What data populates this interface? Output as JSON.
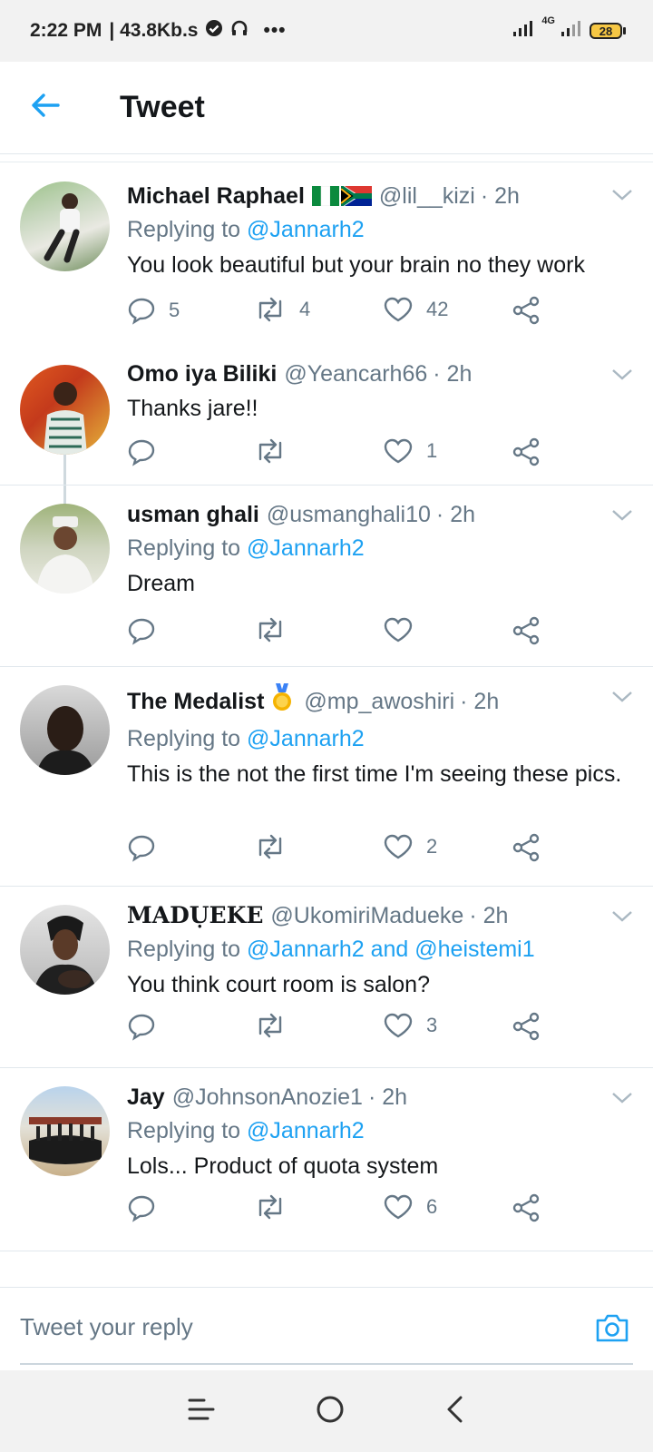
{
  "status_bar": {
    "time": "2:22 PM",
    "network_speed": "| 43.8Kb.s",
    "more": "•••",
    "network_type": "4G",
    "battery_level": "28"
  },
  "header": {
    "title": "Tweet"
  },
  "tweets": [
    {
      "name": "Michael Raphael",
      "handle": "@lil__kizi",
      "time": "· 2h",
      "flags": [
        "ng",
        "za"
      ],
      "reply_label": "Replying to",
      "reply_to": "@Jannarh2",
      "text": "You look beautiful but your brain no they work",
      "replies": "5",
      "retweets": "4",
      "likes": "42"
    },
    {
      "name": "Omo iya Biliki",
      "handle": "@Yeancarh66",
      "time": "· 2h",
      "text": "Thanks jare!!",
      "replies": "",
      "retweets": "",
      "likes": "1"
    },
    {
      "name": "usman ghali",
      "handle": "@usmanghali10",
      "time": "· 2h",
      "reply_label": "Replying to",
      "reply_to": "@Jannarh2",
      "text": "Dream",
      "replies": "",
      "retweets": "",
      "likes": ""
    },
    {
      "name": "The Medalist",
      "handle": "@mp_awoshiri",
      "time": "· 2h",
      "badge": "medal",
      "reply_label": "Replying to",
      "reply_to": "@Jannarh2",
      "text": "This is the not the first time I'm seeing these pics.",
      "replies": "",
      "retweets": "",
      "likes": "2"
    },
    {
      "name": "MADỤEKE",
      "handle": "@UkomiriMadueke",
      "time": "· 2h",
      "reply_label": "Replying to",
      "reply_to": "@Jannarh2 and @heistemi1",
      "text": "You think court room is salon?",
      "replies": "",
      "retweets": "",
      "likes": "3"
    },
    {
      "name": "Jay",
      "handle": "@JohnsonAnozie1",
      "time": "· 2h",
      "reply_label": "Replying to",
      "reply_to": "@Jannarh2",
      "text": "Lols... Product of quota system",
      "replies": "",
      "retweets": "",
      "likes": "6"
    }
  ],
  "compose": {
    "placeholder": "Tweet your reply"
  },
  "icons": {
    "back": "arrow-left-icon",
    "reply": "reply-icon",
    "retweet": "retweet-icon",
    "like": "heart-icon",
    "share": "share-icon",
    "caret": "chevron-down-icon",
    "camera": "camera-icon"
  },
  "colors": {
    "accent": "#1da1f2",
    "secondary_text": "#657786"
  }
}
